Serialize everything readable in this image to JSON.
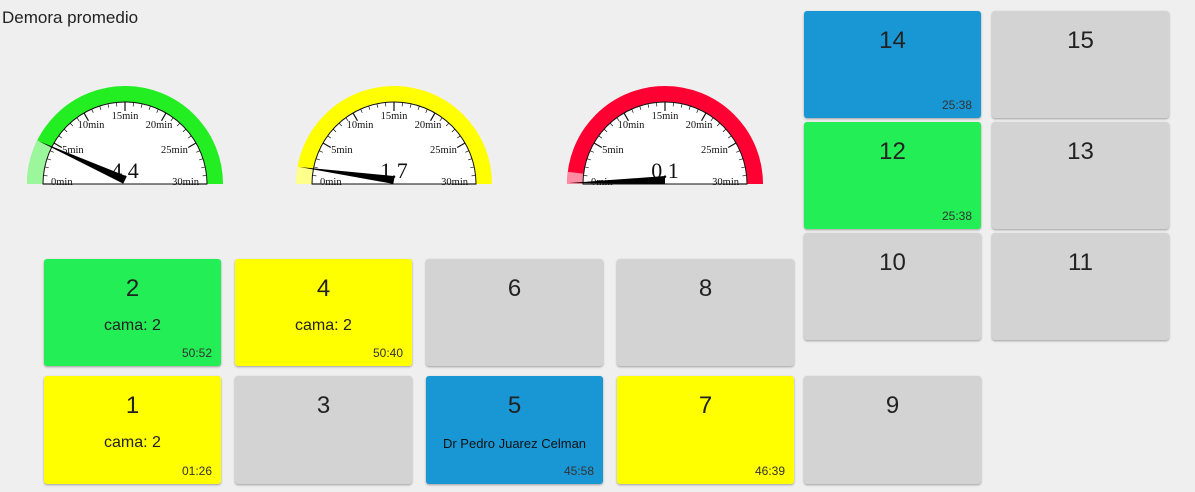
{
  "header": {
    "title": "Demora promedio"
  },
  "gauges": [
    {
      "value": "4.4",
      "numeric": 4.4,
      "color": "#22ee22",
      "min": 0,
      "max": 30,
      "ticks": [
        "0min",
        "5min",
        "10min",
        "15min",
        "20min",
        "25min",
        "30min"
      ]
    },
    {
      "value": "1.7",
      "numeric": 1.7,
      "color": "#ffff00",
      "min": 0,
      "max": 30,
      "ticks": [
        "0min",
        "5min",
        "10min",
        "15min",
        "20min",
        "25min",
        "30min"
      ]
    },
    {
      "value": "0.1",
      "numeric": 0.1,
      "color": "#ff0033",
      "min": 0,
      "max": 30,
      "ticks": [
        "0min",
        "5min",
        "10min",
        "15min",
        "20min",
        "25min",
        "30min"
      ]
    }
  ],
  "tiles": [
    {
      "number": "14",
      "color": "blue",
      "time": "25:38"
    },
    {
      "number": "15",
      "color": "gray"
    },
    {
      "number": "12",
      "color": "green",
      "time": "25:38"
    },
    {
      "number": "13",
      "color": "gray"
    },
    {
      "number": "10",
      "color": "gray"
    },
    {
      "number": "11",
      "color": "gray"
    },
    {
      "number": "2",
      "color": "green",
      "cama": "cama: 2",
      "time": "50:52"
    },
    {
      "number": "4",
      "color": "yellow",
      "cama": "cama: 2",
      "time": "50:40"
    },
    {
      "number": "6",
      "color": "gray"
    },
    {
      "number": "8",
      "color": "gray"
    },
    {
      "number": "1",
      "color": "yellow",
      "cama": "cama: 2",
      "time": "01:26"
    },
    {
      "number": "3",
      "color": "gray"
    },
    {
      "number": "5",
      "color": "blue",
      "doctor": "Dr Pedro Juarez Celman",
      "time": "45:58"
    },
    {
      "number": "7",
      "color": "yellow",
      "time": "46:39"
    },
    {
      "number": "9",
      "color": "gray"
    }
  ]
}
